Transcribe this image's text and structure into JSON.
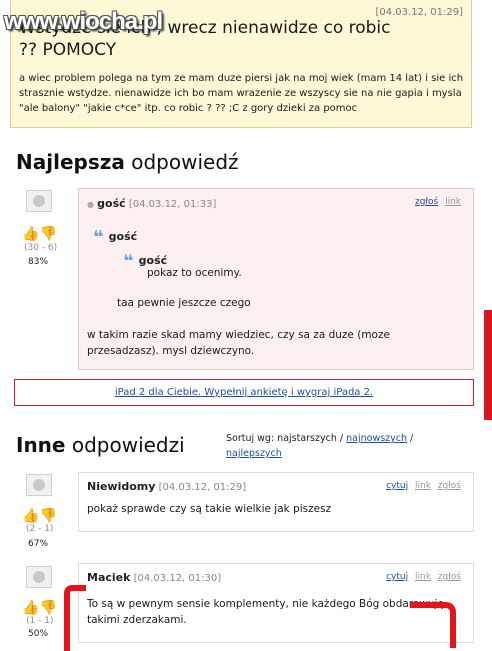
{
  "watermark": "www.wiocha.pl",
  "question": {
    "date": "[04.03.12, 01:29]",
    "title": "Wstydze sie ich , wrecz nienawidze co robic ?? POMOCY",
    "body": "a wiec problem polega na tym ze mam duze piersi jak na moj wiek (mam 14 lat) i sie ich strasznie wstydze. nienawidze ich bo mam wrazenie ze wszyscy sie na nie gapia i mysla \"ale balony\" \"jakie c*ce\" itp. co robic ? ?? ;C z gory dzieki za pomoc"
  },
  "best": {
    "heading_bold": "Najlepsza",
    "heading_light": "odpowiedź",
    "votes": "(30 - 6)",
    "percent": "83%",
    "author": "gość",
    "date": "[04.03.12, 01:33]",
    "link_report": "zgłoś",
    "link_link": "link",
    "quote1_author": "gość",
    "quote2_author": "gość",
    "quote2_text": "pokaz to ocenimy.",
    "quote1_text": "taa pewnie jeszcze czego",
    "reply_text": "w takim razie skad mamy wiedziec, czy sa za duze (moze przesadzasz). mysl dziewczyno."
  },
  "ad": {
    "text": "iPad 2 dla Ciebie. Wypełnij ankietę i wygraj iPada 2."
  },
  "others": {
    "heading_bold": "Inne",
    "heading_light": "odpowiedzi",
    "sort_label": "Sortuj wg: najstarszych /",
    "sort_newest": "najnowszych",
    "sort_sep": "/",
    "sort_best": "najlepszych",
    "answers": [
      {
        "author": "Niewidomy",
        "date": "[04.03.12, 01:29]",
        "cite": "cytuj",
        "link": "link",
        "report": "zgłoś",
        "text": "pokaż sprawde czy są takie wielkie jak piszesz",
        "votes": "(2 - 1)",
        "percent": "67%"
      },
      {
        "author": "Maciek",
        "date": "[04.03.12, 01:30]",
        "cite": "cytuj",
        "link": "link",
        "report": "zgłoś",
        "text": "To są w pewnym sensie komplementy, nie każdego Bóg obdarowuję takimi zderzakami.",
        "votes": "(1 - 1)",
        "percent": "50%"
      }
    ]
  },
  "colors": {
    "accent_red": "#e3141b",
    "link_blue": "#1d4fa5",
    "question_bg": "#fdf8d6",
    "best_bg": "#fdf0f0"
  }
}
